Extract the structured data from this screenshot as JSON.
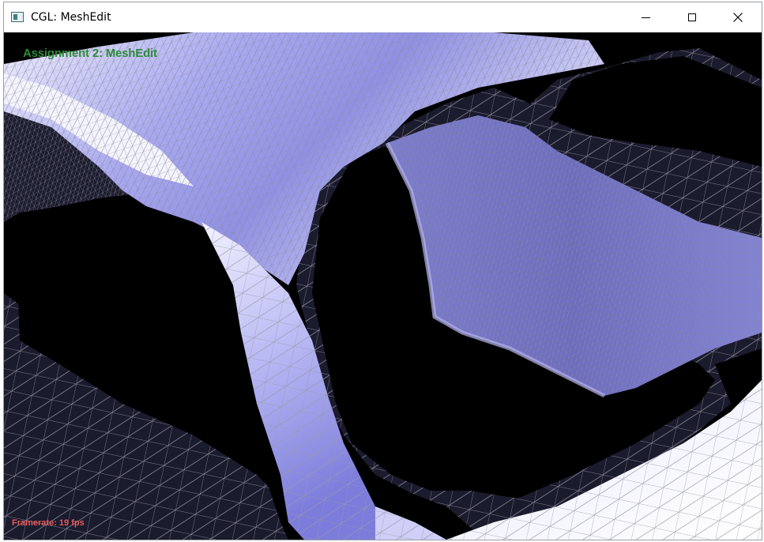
{
  "window": {
    "title": "CGL: MeshEdit",
    "controls": {
      "minimize": "minimize-icon",
      "maximize": "maximize-icon",
      "close": "close-icon"
    }
  },
  "overlay": {
    "assignment_title": "Assignment 2: MeshEdit",
    "framerate": "Framerate: 19 fps"
  },
  "colors": {
    "background": "#000000",
    "mesh_light": "#e4e4ff",
    "mesh_mid": "#8a8ae6",
    "mesh_dark": "#1b1b2e",
    "wire": "#9a9a9a",
    "title_green": "#2f8a3a",
    "fps_red": "#e65a5a"
  }
}
